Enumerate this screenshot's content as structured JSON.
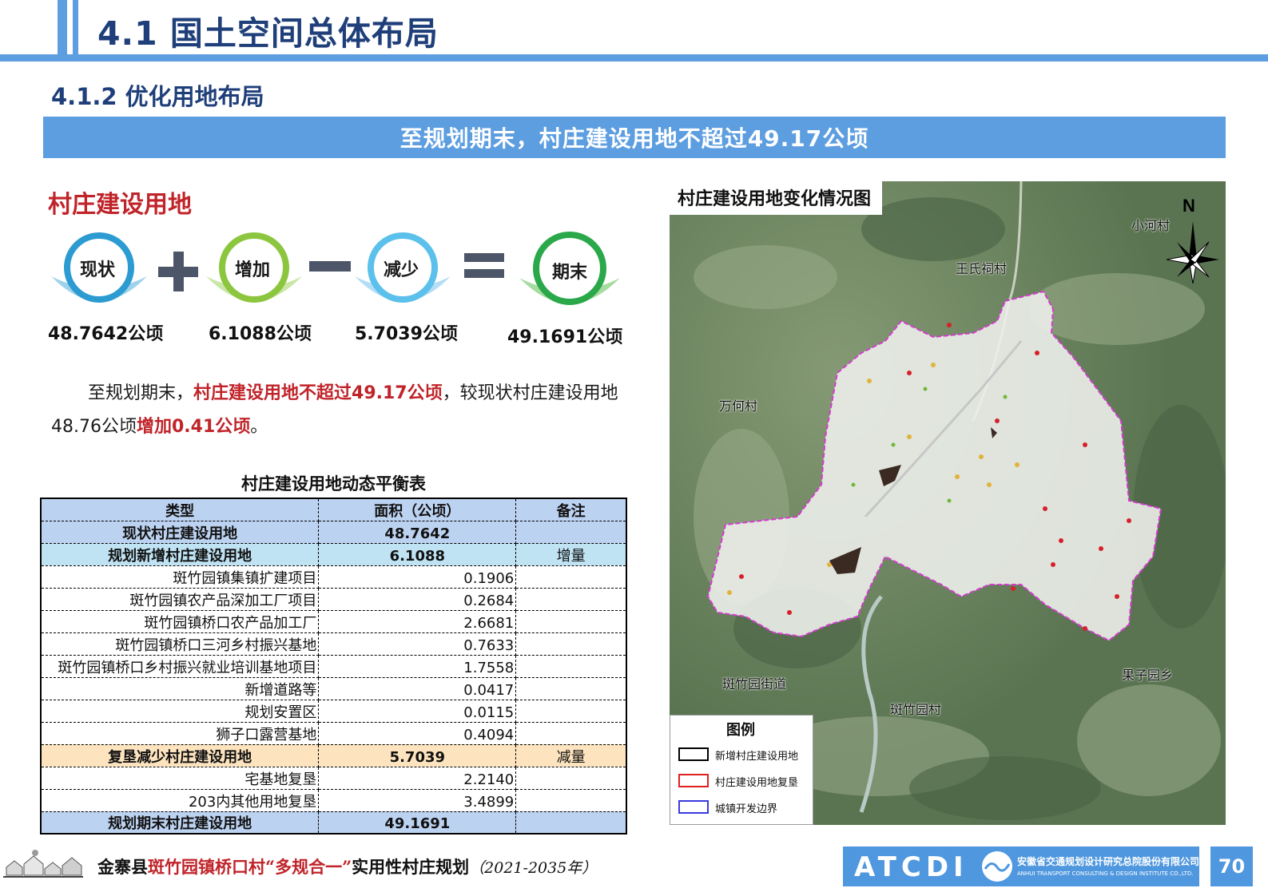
{
  "header": {
    "title": "4.1 国土空间总体布局",
    "section": "4.1.2 优化用地布局",
    "banner": "至规划期末，村庄建设用地不超过49.17公顷"
  },
  "left": {
    "heading": "村庄建设用地",
    "formula": [
      {
        "label": "现状",
        "value": "48.7642公顷",
        "color": "#2b9bd1"
      },
      {
        "label": "增加",
        "value": "6.1088公顷",
        "color": "#8cc63f"
      },
      {
        "label": "减少",
        "value": "5.7039公顷",
        "color": "#5bc0eb"
      },
      {
        "label": "期末",
        "value": "49.1691公顷",
        "color": "#2aa84a"
      }
    ],
    "summary": {
      "t1": "至规划期末，",
      "t2": "村庄建设用地不超过49.17公顷",
      "t3": "，较现状村庄建设用地48.76公顷",
      "t4": "增加0.41公顷",
      "t5": "。"
    }
  },
  "table": {
    "title": "村庄建设用地动态平衡表",
    "headers": [
      "类型",
      "面积（公顷）",
      "备注"
    ],
    "rows": [
      {
        "name": "现状村庄建设用地",
        "area": "48.7642",
        "note": ""
      },
      {
        "name": "规划新增村庄建设用地",
        "area": "6.1088",
        "note": "增量"
      },
      {
        "name": "斑竹园镇集镇扩建项目",
        "area": "0.1906",
        "note": ""
      },
      {
        "name": "斑竹园镇农产品深加工厂项目",
        "area": "0.2684",
        "note": ""
      },
      {
        "name": "斑竹园镇桥口农产品加工厂",
        "area": "2.6681",
        "note": ""
      },
      {
        "name": "斑竹园镇桥口三河乡村振兴基地",
        "area": "0.7633",
        "note": ""
      },
      {
        "name": "斑竹园镇桥口乡村振兴就业培训基地项目",
        "area": "1.7558",
        "note": ""
      },
      {
        "name": "新增道路等",
        "area": "0.0417",
        "note": ""
      },
      {
        "name": "规划安置区",
        "area": "0.0115",
        "note": ""
      },
      {
        "name": "狮子口露营基地",
        "area": "0.4094",
        "note": ""
      },
      {
        "name": "复垦减少村庄建设用地",
        "area": "5.7039",
        "note": "减量"
      },
      {
        "name": "宅基地复垦",
        "area": "2.2140",
        "note": ""
      },
      {
        "name": "203内其他用地复垦",
        "area": "3.4899",
        "note": ""
      },
      {
        "name": "规划期末村庄建设用地",
        "area": "49.1691",
        "note": ""
      }
    ]
  },
  "map": {
    "title": "村庄建设用地变化情况图",
    "north": "N",
    "places": [
      "小河村",
      "王氏祠村",
      "万何村",
      "斑竹园街道",
      "斑竹园村",
      "果子园乡"
    ],
    "legend": {
      "title": "图例",
      "items": [
        {
          "label": "新增村庄建设用地",
          "color": "#000000"
        },
        {
          "label": "村庄建设用地复垦",
          "color": "#e02020"
        },
        {
          "label": "城镇开发边界",
          "color": "#3a3ae0"
        }
      ]
    },
    "boundary_color": "#d63ad1"
  },
  "footer": {
    "t1": "金寨县",
    "t2": "斑竹园镇桥口村",
    "t3": "“多规合一”",
    "t4": "实用性村庄规划",
    "t5": "（2021-2035年）",
    "logo_mark": "ATCDI",
    "logo_cn": "安徽省交通规划设计研究总院股份有限公司",
    "logo_en": "ANHUI TRANSPORT CONSULTING & DESIGN INSTITUTE CO.,LTD.",
    "page": "70"
  },
  "colors": {
    "accent": "#5d9ee0",
    "title": "#1f3f7a",
    "red": "#c0242a"
  }
}
